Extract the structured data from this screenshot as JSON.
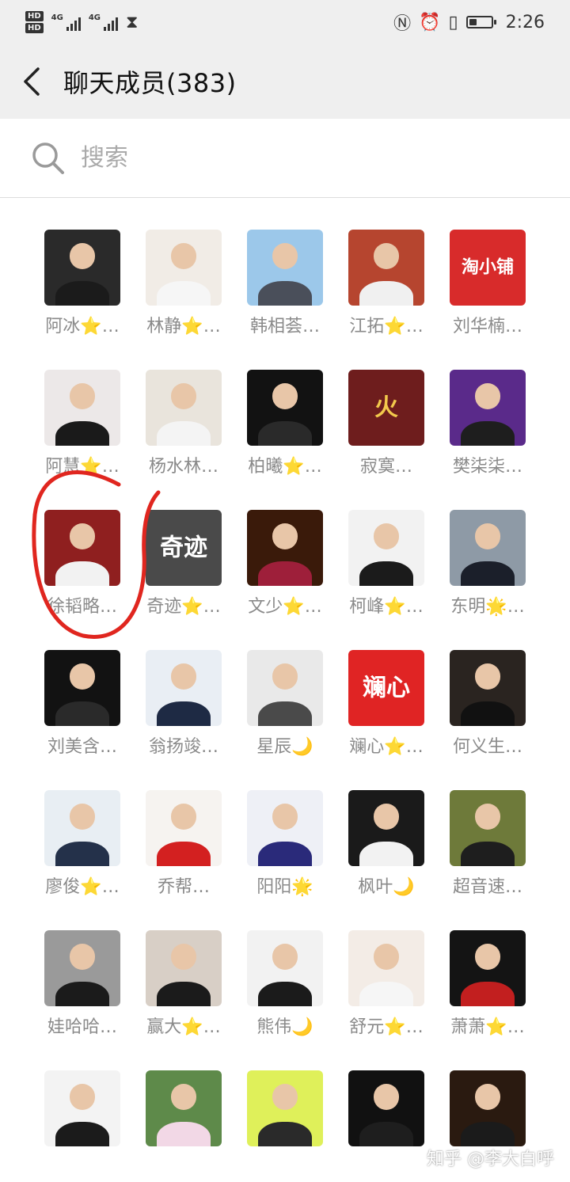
{
  "status_bar": {
    "hd": [
      "HD",
      "HD"
    ],
    "net": [
      "4G",
      "4G"
    ],
    "time": "2:26",
    "battery": 0.35
  },
  "header": {
    "title": "聊天成员(383)"
  },
  "search": {
    "placeholder": "搜索"
  },
  "members": [
    {
      "name": "阿冰⭐…",
      "avatar_bg": "#2a2a2a",
      "body": "#1b1b1b"
    },
    {
      "name": "林静⭐…",
      "avatar_bg": "#f1ece6",
      "body": "#f6f6f6"
    },
    {
      "name": "韩相荟…",
      "avatar_bg": "#9cc8ea",
      "body": "#4a4f5a"
    },
    {
      "name": "江拓⭐…",
      "avatar_bg": "#b6452f",
      "body": "#f0f0f0"
    },
    {
      "name": "刘华楠…",
      "avatar_bg": "#d82b2b",
      "text": "淘小铺",
      "text_color": "#ffffff"
    },
    {
      "name": "阿慧⭐…",
      "avatar_bg": "#ece8e8",
      "body": "#1a1a1a"
    },
    {
      "name": "杨水林…",
      "avatar_bg": "#e9e4dc",
      "body": "#f4f4f4"
    },
    {
      "name": "柏曦⭐…",
      "avatar_bg": "#121212",
      "body": "#2a2a2a"
    },
    {
      "name": "寂寞…",
      "avatar_bg": "#6e1d1d",
      "text": "火",
      "text_color": "#f2c94c"
    },
    {
      "name": "樊柒柒…",
      "avatar_bg": "#5a2a8a",
      "body": "#1e1e1e"
    },
    {
      "name": "徐韬略…",
      "avatar_bg": "#8f1f1f",
      "body": "#f2f2f2"
    },
    {
      "name": "奇迹⭐…",
      "avatar_bg": "#4a4a4a",
      "text": "奇迹",
      "text_color": "#ffffff"
    },
    {
      "name": "文少⭐…",
      "avatar_bg": "#3a1a0a",
      "body": "#9e1f3a"
    },
    {
      "name": "柯峰⭐…",
      "avatar_bg": "#f2f2f2",
      "body": "#1b1b1b"
    },
    {
      "name": "东明🌟…",
      "avatar_bg": "#8e9aa6",
      "body": "#1b1f2a"
    },
    {
      "name": "刘美含…",
      "avatar_bg": "#121212",
      "body": "#2a2a2a"
    },
    {
      "name": "翁扬竣…",
      "avatar_bg": "#e9eef4",
      "body": "#1e2a44"
    },
    {
      "name": "星辰🌙",
      "avatar_bg": "#e9e9e9",
      "body": "#4a4a4a"
    },
    {
      "name": "斓心⭐…",
      "avatar_bg": "#e02424",
      "text": "斓心",
      "text_color": "#ffffff"
    },
    {
      "name": "何义生…",
      "avatar_bg": "#2a2420",
      "body": "#111111"
    },
    {
      "name": "廖俊⭐…",
      "avatar_bg": "#e8eef3",
      "body": "#24314a"
    },
    {
      "name": "乔帮…",
      "avatar_bg": "#f6f3f0",
      "body": "#d32020"
    },
    {
      "name": "阳阳🌟",
      "avatar_bg": "#eef0f6",
      "body": "#2a2a7a"
    },
    {
      "name": "枫叶🌙",
      "avatar_bg": "#1a1a1a",
      "body": "#f2f2f2"
    },
    {
      "name": "超音速…",
      "avatar_bg": "#6e7a3a",
      "body": "#1e1e1e"
    },
    {
      "name": "娃哈哈…",
      "avatar_bg": "#9a9a9a",
      "body": "#1b1b1b"
    },
    {
      "name": "赢大⭐…",
      "avatar_bg": "#d8cfc6",
      "body": "#1b1b1b"
    },
    {
      "name": "熊伟🌙",
      "avatar_bg": "#f2f2f2",
      "body": "#1b1b1b"
    },
    {
      "name": "舒元⭐…",
      "avatar_bg": "#f3ece6",
      "body": "#f6f6f6"
    },
    {
      "name": "萧萧⭐…",
      "avatar_bg": "#141414",
      "body": "#c21f1f"
    },
    {
      "name": "",
      "avatar_bg": "#f3f3f3",
      "body": "#1b1b1b"
    },
    {
      "name": "",
      "avatar_bg": "#5e8a4a",
      "body": "#f2d8e6"
    },
    {
      "name": "",
      "avatar_bg": "#dff05a",
      "body": "#2a2a2a"
    },
    {
      "name": "",
      "avatar_bg": "#111111",
      "body": "#1e1e1e"
    },
    {
      "name": "",
      "avatar_bg": "#2a1a10",
      "body": "#1b1b1b"
    }
  ],
  "watermark": "知乎 @李大白呼",
  "annotation_color": "#e0261f"
}
